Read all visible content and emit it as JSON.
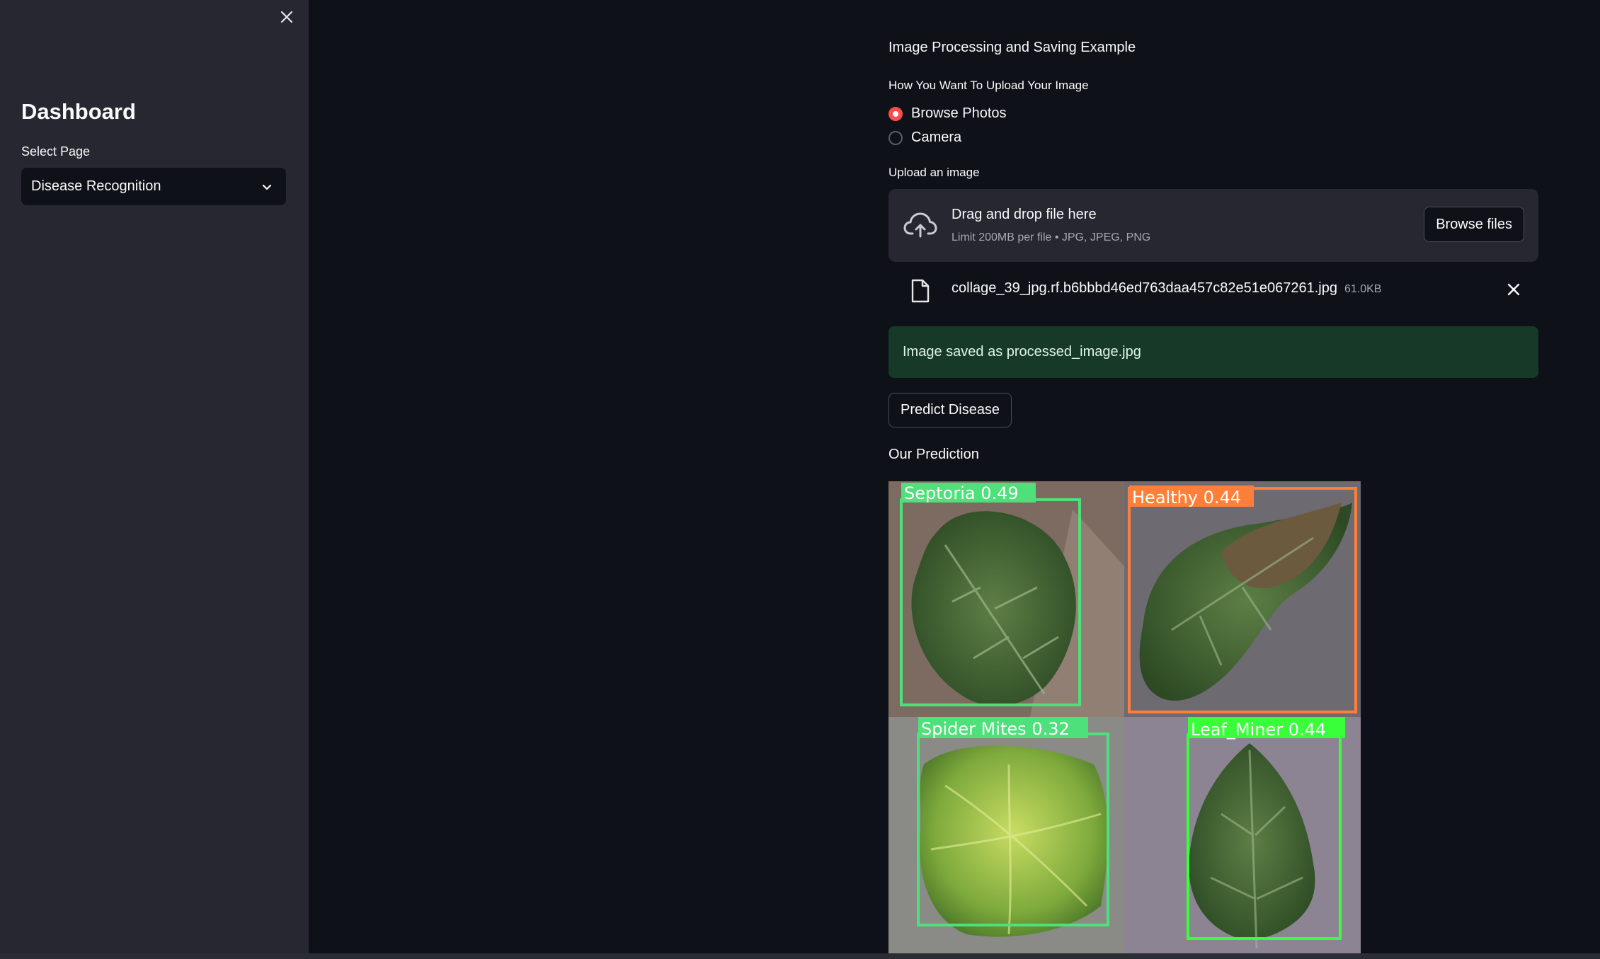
{
  "sidebar": {
    "title": "Dashboard",
    "select_label": "Select Page",
    "select_value": "Disease Recognition",
    "close_icon": "close-icon"
  },
  "main": {
    "title": "Image Processing and Saving Example",
    "upload_method": {
      "label": "How You Want To Upload Your Image",
      "options": [
        {
          "label": "Browse Photos",
          "selected": true
        },
        {
          "label": "Camera",
          "selected": false
        }
      ]
    },
    "uploader": {
      "label": "Upload an image",
      "drop_title": "Drag and drop file here",
      "drop_hint": "Limit 200MB per file • JPG, JPEG, PNG",
      "browse_label": "Browse files",
      "icon": "cloud-upload-icon"
    },
    "uploaded_file": {
      "name": "collage_39_jpg.rf.b6bbbd46ed763daa457c82e51e067261.jpg",
      "size": "61.0KB",
      "icon": "file-icon"
    },
    "success_message": "Image saved as processed_image.jpg",
    "predict_button": "Predict Disease",
    "prediction_label": "Our Prediction",
    "detections": [
      {
        "label": "Septoria 0.49",
        "color": "#4ee07a"
      },
      {
        "label": "Healthy 0.44",
        "color": "#ff7f3a"
      },
      {
        "label": "Spider Mites 0.32",
        "color": "#4ee07a"
      },
      {
        "label": "Leaf_Miner 0.44",
        "color": "#39ff3a"
      }
    ]
  },
  "colors": {
    "background": "#0e1118",
    "sidebar": "#262730",
    "accent": "#ff4b4b",
    "success_bg": "#173928"
  }
}
